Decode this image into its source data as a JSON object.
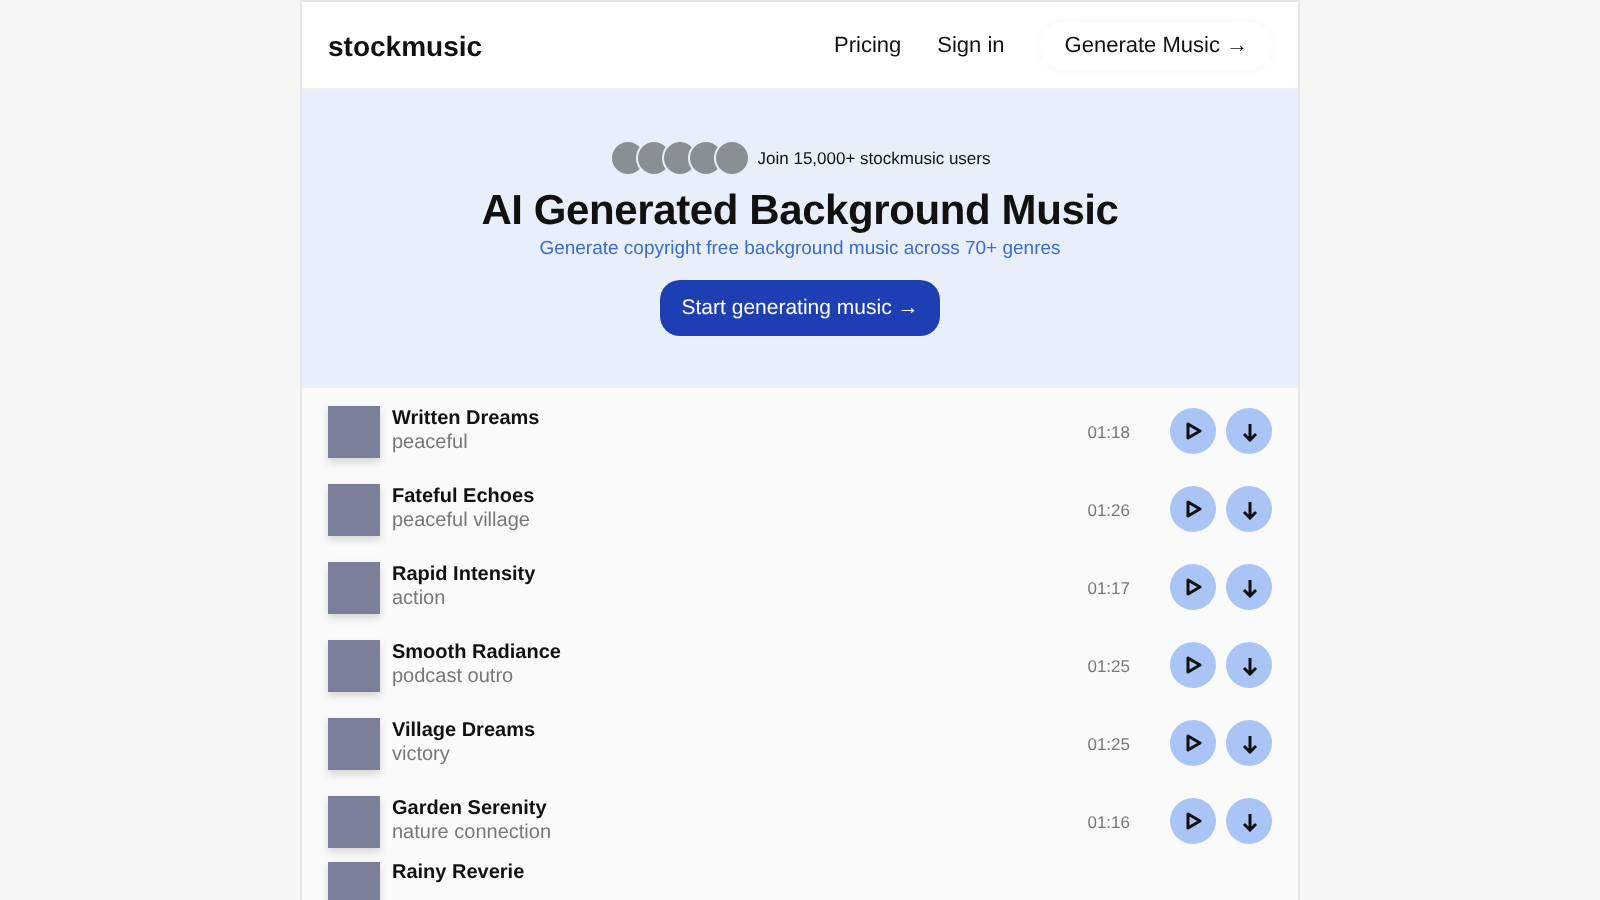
{
  "header": {
    "logo": "stockmusic",
    "nav": [
      "Pricing",
      "Sign in"
    ],
    "cta": "Generate Music →"
  },
  "hero": {
    "social_proof": "Join 15,000+ stockmusic users",
    "title": "AI Generated Background Music",
    "subtitle": "Generate copyright free background music across 70+ genres",
    "button": "Start generating music →"
  },
  "tracks": [
    {
      "title": "Written Dreams",
      "tag": "peaceful",
      "duration": "01:18"
    },
    {
      "title": "Fateful Echoes",
      "tag": "peaceful village",
      "duration": "01:26"
    },
    {
      "title": "Rapid Intensity",
      "tag": "action",
      "duration": "01:17"
    },
    {
      "title": "Smooth Radiance",
      "tag": "podcast outro",
      "duration": "01:25"
    },
    {
      "title": "Village Dreams",
      "tag": "victory",
      "duration": "01:25"
    },
    {
      "title": "Garden Serenity",
      "tag": "nature connection",
      "duration": "01:16"
    },
    {
      "title": "Rainy Reverie"
    }
  ]
}
